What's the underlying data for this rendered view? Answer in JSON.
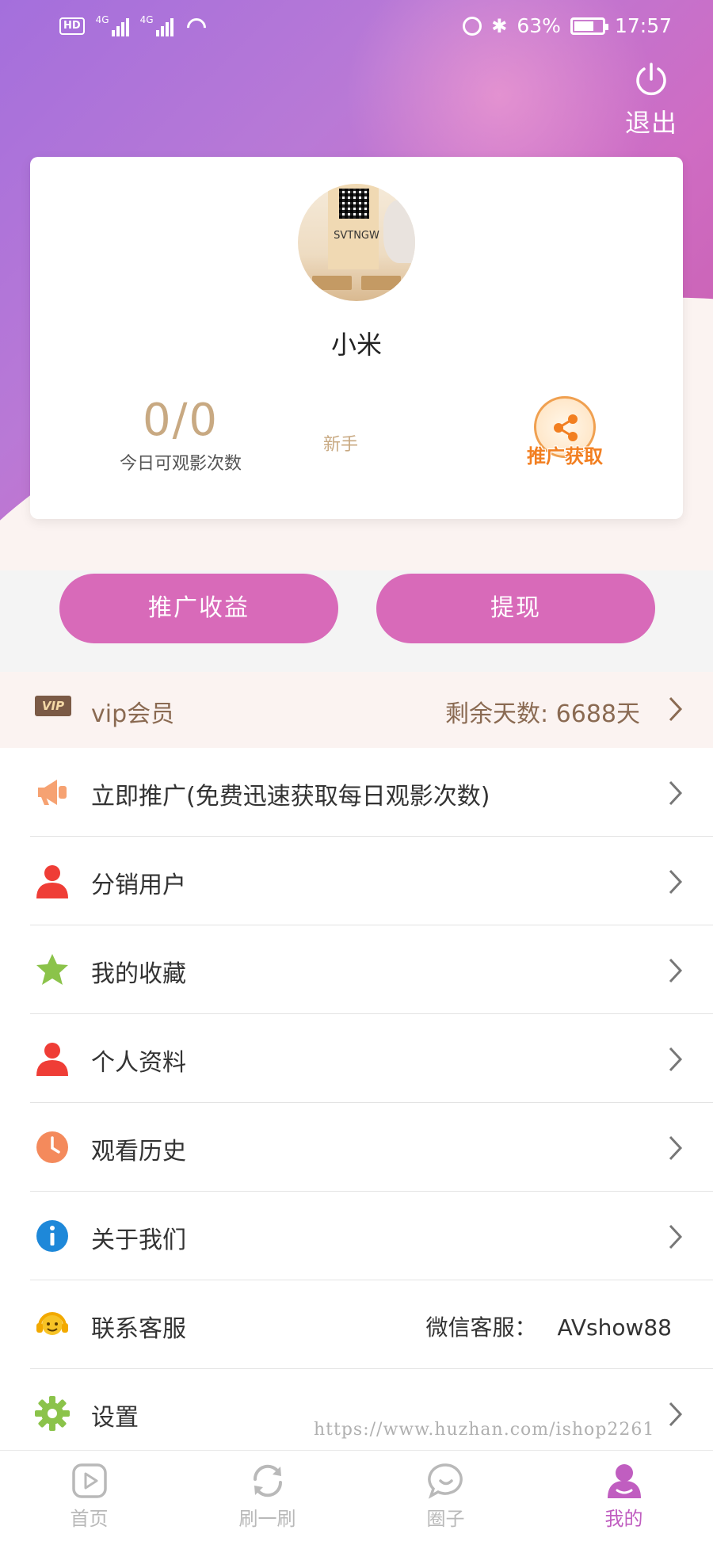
{
  "status_bar": {
    "hd": "HD",
    "sim1_network": "4G",
    "sim2_network": "4G",
    "battery": "63%",
    "time": "17:57"
  },
  "header": {
    "logout_label": "退出"
  },
  "profile": {
    "avatar_text": "SVTNGW",
    "name": "小米",
    "views_value": "0/0",
    "views_label": "今日可观影次数",
    "level": "新手",
    "promo_label": "推广获取"
  },
  "actions": {
    "earnings_label": "推广收益",
    "withdraw_label": "提现"
  },
  "vip": {
    "badge": "VIP",
    "title": "vip会员",
    "remaining": "剩余天数: 6688天"
  },
  "menu": {
    "items": [
      {
        "label": "立即推广(免费迅速获取每日观影次数)",
        "icon": "megaphone-icon"
      },
      {
        "label": "分销用户",
        "icon": "user-icon"
      },
      {
        "label": "我的收藏",
        "icon": "star-icon"
      },
      {
        "label": "个人资料",
        "icon": "user-icon"
      },
      {
        "label": "观看历史",
        "icon": "clock-icon"
      },
      {
        "label": "关于我们",
        "icon": "info-icon"
      },
      {
        "label": "联系客服",
        "icon": "headset-icon",
        "extra_key": "微信客服：",
        "extra_value": "AVshow88"
      },
      {
        "label": "设置",
        "icon": "gear-icon"
      }
    ]
  },
  "watermark": "https://www.huzhan.com/ishop2261",
  "tabbar": {
    "tabs": [
      {
        "label": "首页",
        "icon": "play-icon"
      },
      {
        "label": "刷一刷",
        "icon": "refresh-icon"
      },
      {
        "label": "圈子",
        "icon": "chat-bubble-icon"
      },
      {
        "label": "我的",
        "icon": "profile-icon",
        "active": true
      }
    ]
  },
  "colors": {
    "accent": "#d86ab9",
    "gold_text": "#c8a982",
    "vip_text": "#8a6a52",
    "active_tab": "#c05ec0",
    "promo_orange": "#f27f21"
  }
}
